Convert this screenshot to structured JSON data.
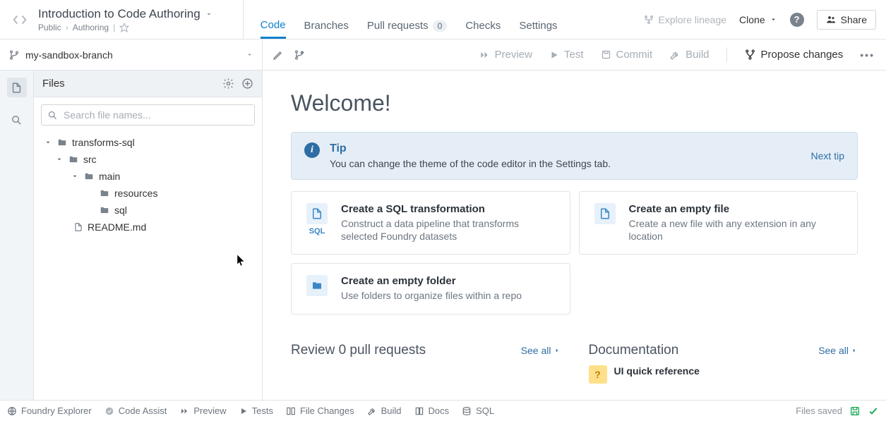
{
  "header": {
    "title": "Introduction to Code Authoring",
    "breadcrumb": [
      "Public",
      "Authoring"
    ],
    "tabs": [
      {
        "label": "Code",
        "active": true
      },
      {
        "label": "Branches"
      },
      {
        "label": "Pull requests",
        "count": "0"
      },
      {
        "label": "Checks"
      },
      {
        "label": "Settings"
      }
    ],
    "explore_lineage": "Explore lineage",
    "clone": "Clone",
    "share": "Share"
  },
  "toolbar": {
    "branch": "my-sandbox-branch",
    "preview": "Preview",
    "test": "Test",
    "commit": "Commit",
    "build": "Build",
    "propose": "Propose changes"
  },
  "sidebar": {
    "title": "Files",
    "search_placeholder": "Search file names...",
    "tree": {
      "root": "transforms-sql",
      "src": "src",
      "main": "main",
      "resources": "resources",
      "sql": "sql",
      "readme": "README.md"
    }
  },
  "main": {
    "welcome": "Welcome!",
    "tip": {
      "title": "Tip",
      "text": "You can change the theme of the code editor in the Settings tab.",
      "next": "Next tip"
    },
    "cards": [
      {
        "title": "Create a SQL transformation",
        "desc": "Construct a data pipeline that transforms selected Foundry datasets",
        "icon_label": "SQL"
      },
      {
        "title": "Create an empty file",
        "desc": "Create a new file with any extension in any location"
      },
      {
        "title": "Create an empty folder",
        "desc": "Use folders to organize files within a repo"
      }
    ],
    "review": {
      "title": "Review 0 pull requests",
      "see_all": "See all"
    },
    "documentation": {
      "title": "Documentation",
      "see_all": "See all",
      "item1": "UI quick reference"
    }
  },
  "footer": {
    "foundry_explorer": "Foundry Explorer",
    "code_assist": "Code Assist",
    "preview": "Preview",
    "tests": "Tests",
    "file_changes": "File Changes",
    "build": "Build",
    "docs": "Docs",
    "sql": "SQL",
    "files_saved": "Files saved"
  }
}
